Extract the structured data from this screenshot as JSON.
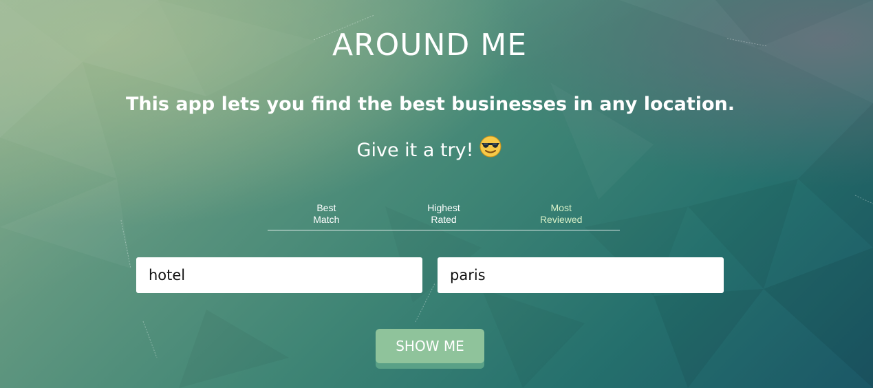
{
  "header": {
    "title": "AROUND ME",
    "subtitle": "This app lets you find the best businesses in any location.",
    "cta_text": "Give it a try!",
    "cta_emoji": "sunglasses-emoji-icon"
  },
  "sort_tabs": [
    {
      "line1": "Best",
      "line2": "Match",
      "active": false
    },
    {
      "line1": "Highest",
      "line2": "Rated",
      "active": false
    },
    {
      "line1": "Most",
      "line2": "Reviewed",
      "active": true
    }
  ],
  "search": {
    "term_value": "hotel",
    "location_value": "paris"
  },
  "submit_label": "SHOW ME",
  "colors": {
    "button": "#8fc39b",
    "button_shadow": "#5aa187",
    "active_tab": "#d8f0c8",
    "text": "#ffffff"
  }
}
